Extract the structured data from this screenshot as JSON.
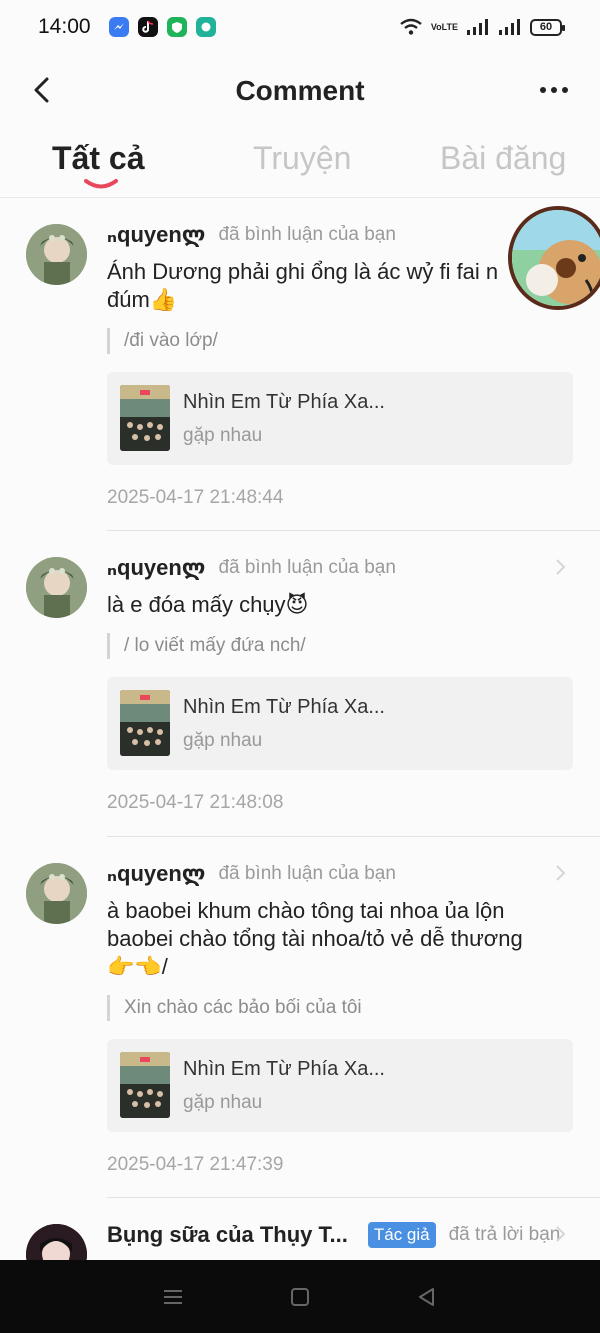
{
  "status_bar": {
    "time": "14:00",
    "network_label": "VoLTE",
    "battery": "60",
    "apps": [
      "messenger-icon",
      "tiktok-icon",
      "vpn-shield-icon",
      "chat-icon"
    ],
    "colors": {
      "messenger": "#3a7bf2",
      "tiktok": "#111111",
      "vpn": "#1fb45a",
      "chat": "#20b39a"
    }
  },
  "header": {
    "title": "Comment"
  },
  "tabs": [
    {
      "label": "Tất cả",
      "active": true
    },
    {
      "label": "Truyện",
      "active": false
    },
    {
      "label": "Bài đăng",
      "active": false
    }
  ],
  "accent_color": "#e8475c",
  "comments": [
    {
      "author": "ₙquyenლ",
      "action": "đã bình luận của bạn",
      "text_line1": "Ánh Dương phải ghi ổng là ác wỷ fi fai n",
      "text_line2": "đúm👍",
      "quote": "/đi vào lớp/",
      "card_title": "Nhìn Em Từ Phía Xa...",
      "card_sub": "gặp nhau",
      "timestamp": "2025-04-17 21:48:44"
    },
    {
      "author": "ₙquyenლ",
      "action": "đã bình luận của bạn",
      "text_line1": "là e đóa mấy chụy😈",
      "quote": "/ lo viết mấy đứa nch/",
      "card_title": "Nhìn Em Từ Phía Xa...",
      "card_sub": "gặp nhau",
      "timestamp": "2025-04-17 21:48:08"
    },
    {
      "author": "ₙquyenლ",
      "action": "đã bình luận của bạn",
      "text_line1": "à baobei khum chào tông tai nhoa ủa lộn",
      "text_line2": "baobei chào tổng tài nhoa/tỏ vẻ dễ thương",
      "text_line3": "👉👈/",
      "quote": "Xin chào các bảo bối của tôi",
      "card_title": "Nhìn Em Từ Phía Xa...",
      "card_sub": "gặp nhau",
      "timestamp": "2025-04-17 21:47:39"
    }
  ],
  "last_item": {
    "author": "Bụng sữa của Thụy T...",
    "badge": "Tác giả",
    "action": "đã trả lời bạn"
  }
}
